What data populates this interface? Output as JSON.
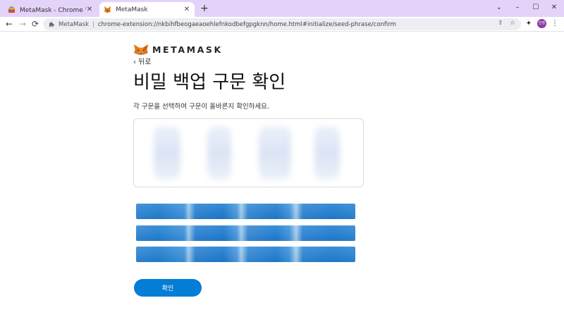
{
  "browser": {
    "tabs": [
      {
        "title": "MetaMask - Chrome 웹 스토어",
        "close": "✕"
      },
      {
        "title": "MetaMask",
        "close": "✕"
      }
    ],
    "new_tab": "+",
    "window_controls": {
      "minimize": "⌄",
      "minimize2": "–",
      "maximize": "☐",
      "close": "✕"
    },
    "nav": {
      "back": "←",
      "forward": "→",
      "reload": "⟳"
    },
    "omnibox": {
      "origin": "MetaMask",
      "separator": "|",
      "url": "chrome-extension://nkbihfbeogaeaoehlefnkodbefgpgknn/home.html#initialize/seed-phrase/confirm"
    },
    "toolbar_icons": {
      "share": "⇪",
      "bookmark": "☆",
      "extensions": "✦",
      "menu": "⋮"
    },
    "profile_avatar": "인영"
  },
  "page": {
    "brand": "METAMASK",
    "back_link": "‹ 뒤로",
    "heading": "비밀 백업 구문 확인",
    "instruction": "각 구문을 선택하여 구문이 올바른지 확인하세요.",
    "confirm_label": "확인"
  },
  "colors": {
    "tab_strip": "#e4d3f8",
    "primary": "#037dd6"
  }
}
